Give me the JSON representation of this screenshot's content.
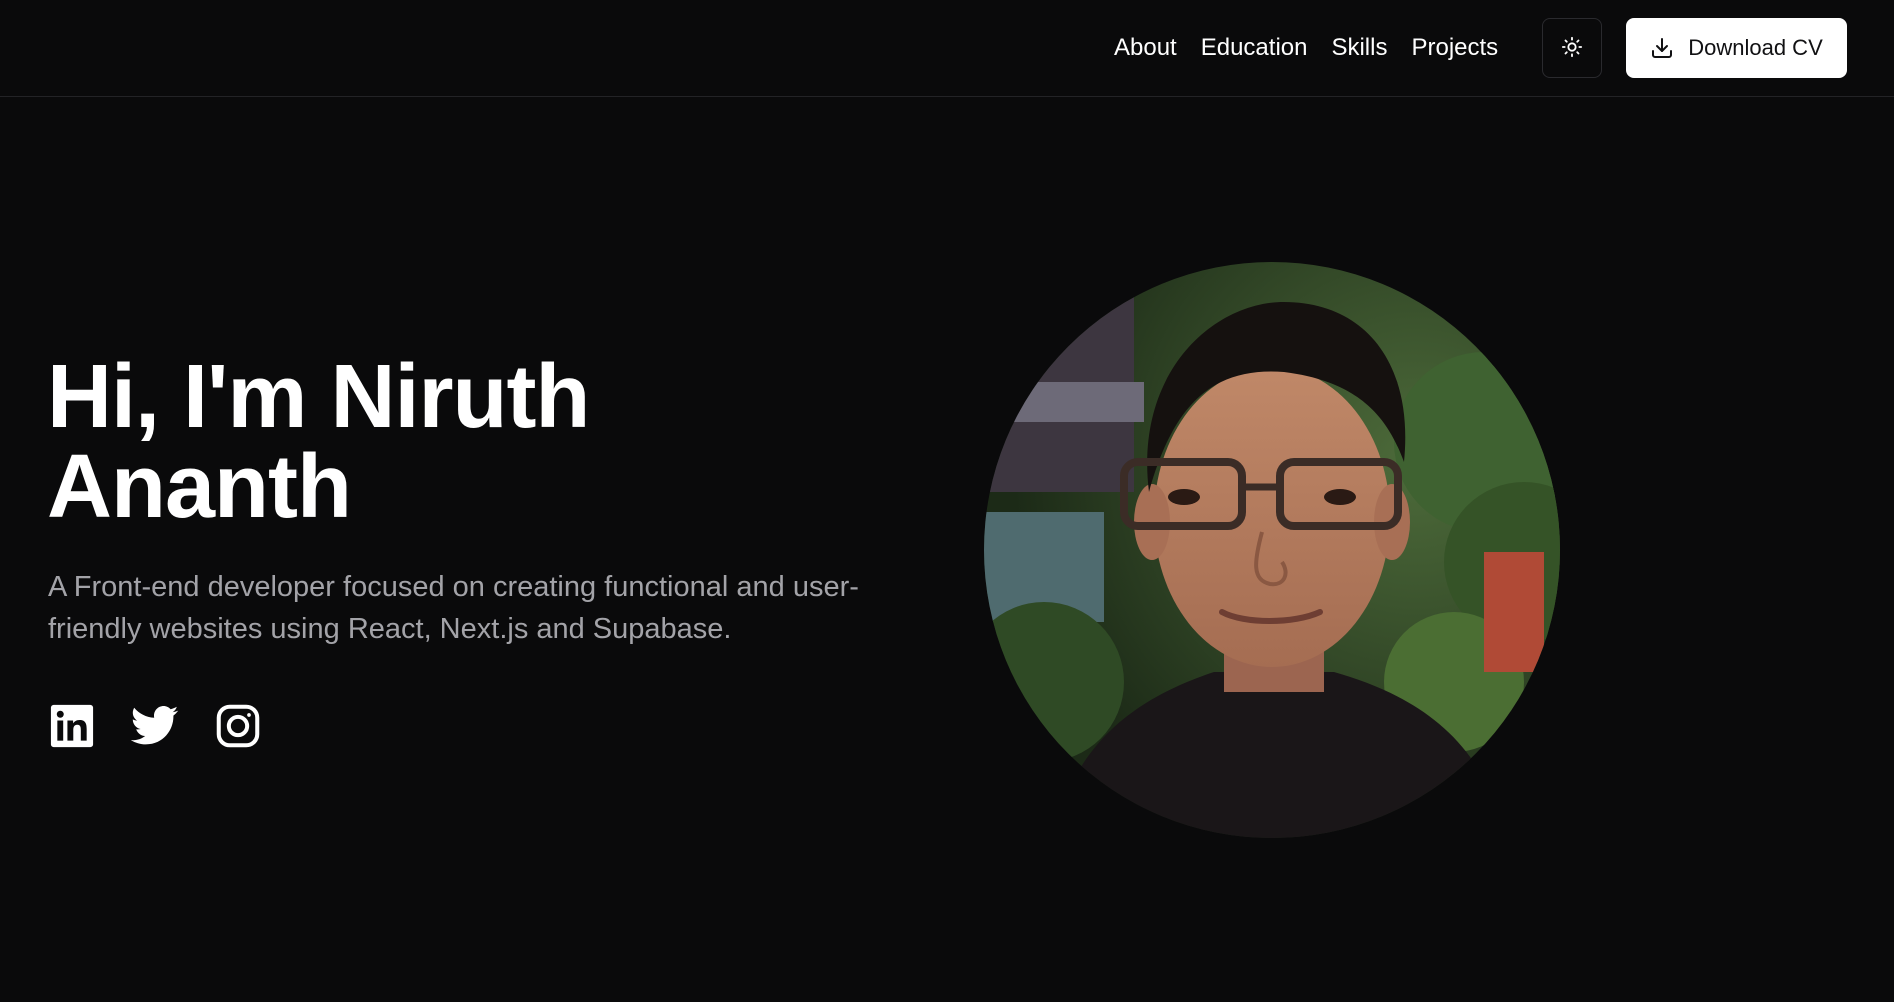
{
  "nav": {
    "links": [
      "About",
      "Education",
      "Skills",
      "Projects"
    ],
    "theme_toggle_icon": "sun-icon",
    "cv_button": {
      "label": "Download CV",
      "icon": "download-icon"
    }
  },
  "hero": {
    "title_line1": "Hi, I'm Niruth",
    "title_line2": "Ananth",
    "description": "A Front-end developer focused on creating functional and user-friendly websites using React, Next.js and Supabase.",
    "socials": [
      "linkedin-icon",
      "twitter-icon",
      "instagram-icon"
    ],
    "portrait": "profile-photo"
  },
  "colors": {
    "background": "#0a0a0b",
    "text": "#ffffff",
    "muted_text": "#a3a3a8",
    "border": "#232326",
    "button_bg": "#ffffff",
    "button_text": "#111113"
  }
}
